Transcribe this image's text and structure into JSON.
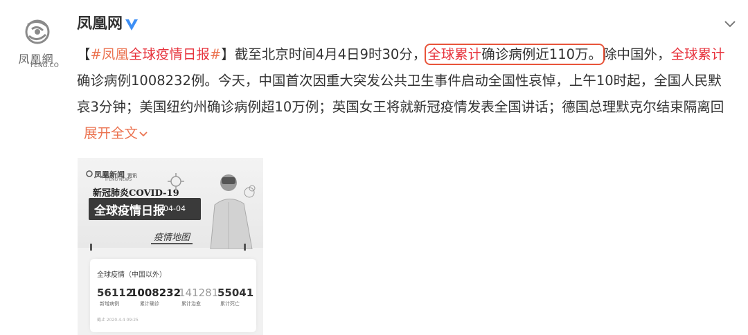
{
  "account": {
    "name": "凤凰网",
    "logo_cn": "凤凰網",
    "logo_en": "FENG.CO"
  },
  "post": {
    "bracket_open": "【",
    "topic_hash_1": "#凤凰",
    "topic_highlight": "全球疫情日报",
    "topic_hash_2": "#",
    "bracket_close": "】",
    "text_1": "截至北京时间4月4日9时30分，",
    "boxed_highlight": "全球累计",
    "boxed_text": "确诊病例近110万。",
    "text_2": "除中国外，",
    "highlight_2": "全球累计",
    "text_3": "确诊病例1008232例。今天，中国首次因重大突发公共卫生事件启动全国性哀悼，上午10时起，全国人民默哀3分钟；美国纽约州确诊病例超10万例；英国女王将就新冠疫情发表全国讲话；德国总理默克尔结束隔离回",
    "expand_label": "展开全文"
  },
  "card": {
    "brand": "凤凰新闻",
    "brand_tag": "资讯",
    "brand_sub": "IFENG NEWS",
    "subtitle": "新冠肺炎COVID-19",
    "title": "全球疫情日报",
    "title_date": "04-04",
    "map_label": "疫情地图",
    "stats_head": "全球疫情（中国以外）",
    "stats": [
      {
        "value": "56112",
        "label": "新增病例",
        "color": "#333333"
      },
      {
        "value": "1008232",
        "label": "累计确诊",
        "color": "#222222"
      },
      {
        "value": "141281",
        "label": "累计治愈",
        "color": "#999999"
      },
      {
        "value": "55041",
        "label": "累计死亡",
        "color": "#333333"
      }
    ],
    "stats_time": "截止 2020.4.4 09:25"
  },
  "colors": {
    "link": "#eb7350",
    "highlight": "#e7333d",
    "box": "#e8543a",
    "verified": "#3d8ff5"
  }
}
